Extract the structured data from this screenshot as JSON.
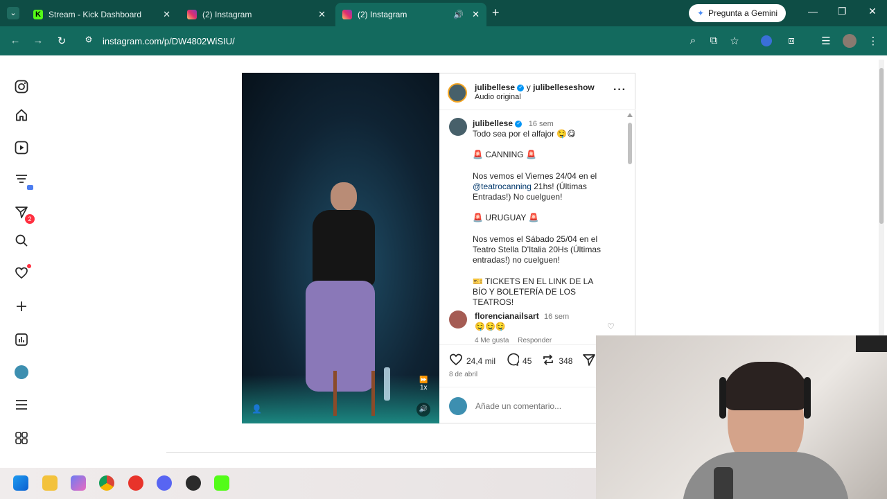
{
  "browser": {
    "tabs": [
      {
        "title": "Stream - Kick Dashboard",
        "favicon": "kick-icon"
      },
      {
        "title": "(2) Instagram",
        "favicon": "instagram-icon"
      },
      {
        "title": "(2) Instagram",
        "favicon": "instagram-icon",
        "active": true
      }
    ],
    "gemini_label": "Pregunta a Gemini",
    "url": "instagram.com/p/DW4802WiSIU/"
  },
  "post": {
    "header": {
      "author": "julibellese",
      "connector": "y",
      "coauthor": "julibelleseshow",
      "audio": "Audio original"
    },
    "caption": {
      "author": "julibellese",
      "age": "16 sem",
      "line1": "Todo sea por el alfajor 🤤😋",
      "canning": "🚨 CANNING 🚨",
      "canning_text_a": "Nos vemos el Viernes 24/04 en el",
      "canning_mention": "@teatrocanning",
      "canning_text_b": " 21hs! (Últimas Entradas!) No cuelguen!",
      "uruguay": "🚨 URUGUAY 🚨",
      "uruguay_text": "Nos vemos el Sábado 25/04 en el Teatro Stella D'Italia 20Hs (Últimas entradas!) no cuelguen!",
      "tickets": "🎫 TICKETS EN EL LINK DE LA BÍO Y BOLETERÍA DE LOS TEATROS!"
    },
    "comment": {
      "author": "florencianailsart",
      "age": "16 sem",
      "text": "🤤🤤🤤",
      "likes": "4 Me gusta",
      "reply": "Responder"
    },
    "actions": {
      "likes": "24,4 mil",
      "comments": "45",
      "reposts": "348"
    },
    "date": "8 de abril",
    "comment_placeholder": "Añade un comentario..."
  },
  "video": {
    "speed_label": "1x"
  },
  "colors": {
    "tab_bar": "#0e4d45",
    "address_bar": "#136a5e",
    "verified": "#0095f6",
    "notification": "#ff3040"
  }
}
